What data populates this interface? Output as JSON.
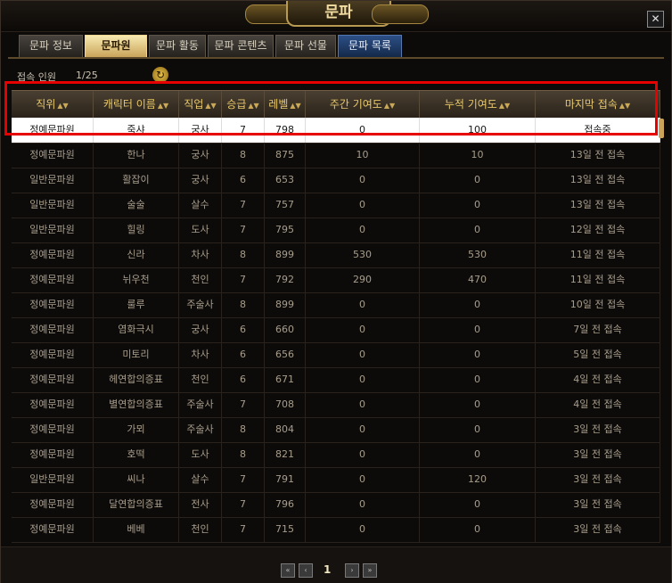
{
  "window": {
    "title": "문파",
    "close_glyph": "✕"
  },
  "tabs": [
    {
      "label": "문파 정보"
    },
    {
      "label": "문파원"
    },
    {
      "label": "문파 활동"
    },
    {
      "label": "문파 콘텐츠"
    },
    {
      "label": "문파 선물"
    },
    {
      "label": "문파 목록"
    }
  ],
  "online": {
    "label": "접속 인원",
    "count": "1/25",
    "refresh_icon": "refresh-icon"
  },
  "sort_glyph": "▲▼",
  "columns": [
    "직위",
    "캐릭터 이름",
    "직업",
    "승급",
    "레벨",
    "주간 기여도",
    "누적 기여도",
    "마지막 접속"
  ],
  "members": [
    [
      "정예문파원",
      "죽샤",
      "궁사",
      "7",
      "798",
      "0",
      "100",
      "접속중"
    ],
    [
      "정예문파원",
      "한나",
      "궁사",
      "8",
      "875",
      "10",
      "10",
      "13일 전 접속"
    ],
    [
      "일반문파원",
      "활잡이",
      "궁사",
      "6",
      "653",
      "0",
      "0",
      "13일 전 접속"
    ],
    [
      "일반문파원",
      "술술",
      "살수",
      "7",
      "757",
      "0",
      "0",
      "13일 전 접속"
    ],
    [
      "일반문파원",
      "힐링",
      "도사",
      "7",
      "795",
      "0",
      "0",
      "12일 전 접속"
    ],
    [
      "정예문파원",
      "신라",
      "차사",
      "8",
      "899",
      "530",
      "530",
      "11일 전 접속"
    ],
    [
      "정예문파원",
      "뉘우천",
      "천인",
      "7",
      "792",
      "290",
      "470",
      "11일 전 접속"
    ],
    [
      "정예문파원",
      "룰루",
      "주술사",
      "8",
      "899",
      "0",
      "0",
      "10일 전 접속"
    ],
    [
      "정예문파원",
      "염화극시",
      "궁사",
      "6",
      "660",
      "0",
      "0",
      "7일 전 접속"
    ],
    [
      "정예문파원",
      "미토리",
      "차사",
      "6",
      "656",
      "0",
      "0",
      "5일 전 접속"
    ],
    [
      "정예문파원",
      "헤연합의증표",
      "천인",
      "6",
      "671",
      "0",
      "0",
      "4일 전 접속"
    ],
    [
      "정예문파원",
      "별연합의증표",
      "주술사",
      "7",
      "708",
      "0",
      "0",
      "4일 전 접속"
    ],
    [
      "정예문파원",
      "가뫼",
      "주술사",
      "8",
      "804",
      "0",
      "0",
      "3일 전 접속"
    ],
    [
      "정예문파원",
      "호떡",
      "도사",
      "8",
      "821",
      "0",
      "0",
      "3일 전 접속"
    ],
    [
      "일반문파원",
      "씨나",
      "살수",
      "7",
      "791",
      "0",
      "120",
      "3일 전 접속"
    ],
    [
      "정예문파원",
      "달연합의증표",
      "전사",
      "7",
      "796",
      "0",
      "0",
      "3일 전 접속"
    ],
    [
      "정예문파원",
      "베베",
      "천인",
      "7",
      "715",
      "0",
      "0",
      "3일 전 접속"
    ]
  ],
  "pager": {
    "first": "«",
    "prev": "‹",
    "current": "1",
    "next": "›",
    "last": "»"
  },
  "colors": {
    "accent_gold": "#e8c86a",
    "highlight_red": "#e60000",
    "selected_row": "#ffffff"
  }
}
